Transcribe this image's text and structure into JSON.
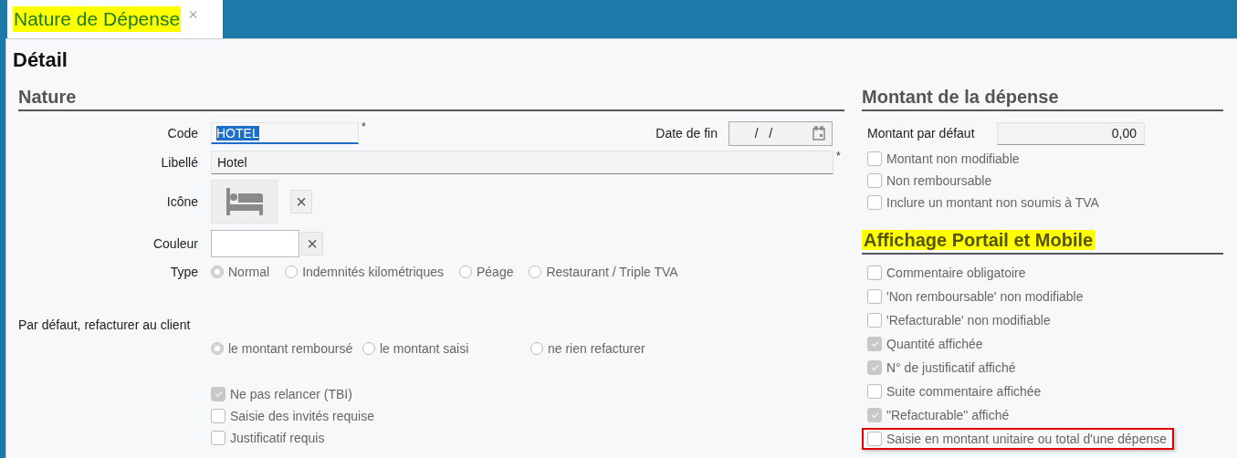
{
  "tab": {
    "title": "Nature de Dépense",
    "highlighted": true,
    "close": "×"
  },
  "heading": "Détail",
  "nature": {
    "title": "Nature",
    "code": {
      "label": "Code",
      "value": "HOTEL",
      "required": "*"
    },
    "end_date": {
      "label": "Date de fin",
      "value": "  /   /"
    },
    "libelle": {
      "label": "Libellé",
      "value": "Hotel",
      "required": "*"
    },
    "icon": {
      "label": "Icône",
      "clear": "×"
    },
    "color": {
      "label": "Couleur",
      "clear": "×"
    },
    "type": {
      "label": "Type",
      "options": [
        {
          "label": "Normal",
          "selected": true
        },
        {
          "label": "Indemnités kilométriques",
          "selected": false
        },
        {
          "label": "Péage",
          "selected": false
        },
        {
          "label": "Restaurant / Triple TVA",
          "selected": false
        }
      ]
    },
    "rebill": {
      "label": "Par défaut, refacturer au client",
      "options": [
        {
          "label": "le montant remboursé",
          "selected": true
        },
        {
          "label": "le montant saisi",
          "selected": false
        },
        {
          "label": "ne rien refacturer",
          "selected": false
        }
      ]
    },
    "checks": [
      {
        "label": "Ne pas relancer (TBI)",
        "checked": true
      },
      {
        "label": "Saisie des invités requise",
        "checked": false
      },
      {
        "label": "Justificatif requis",
        "checked": false
      }
    ]
  },
  "amount": {
    "title": "Montant de la dépense",
    "default": {
      "label": "Montant par défaut",
      "value": "0,00"
    },
    "checks": [
      {
        "label": "Montant non modifiable",
        "checked": false
      },
      {
        "label": "Non remboursable",
        "checked": false
      },
      {
        "label": "Inclure un montant non soumis à TVA",
        "checked": false
      }
    ]
  },
  "display": {
    "title": "Affichage Portail et Mobile",
    "highlighted": true,
    "checks": [
      {
        "label": "Commentaire obligatoire",
        "checked": false,
        "outlined": false
      },
      {
        "label": "'Non remboursable' non modifiable",
        "checked": false,
        "outlined": false
      },
      {
        "label": "'Refacturable' non modifiable",
        "checked": false,
        "outlined": false
      },
      {
        "label": "Quantité affichée",
        "checked": true,
        "outlined": false
      },
      {
        "label": "N° de justificatif affiché",
        "checked": true,
        "outlined": false
      },
      {
        "label": "Suite commentaire affichée",
        "checked": false,
        "outlined": false
      },
      {
        "label": "\"Refacturable\" affiché",
        "checked": true,
        "outlined": false
      },
      {
        "label": "Saisie en montant unitaire ou total d'une dépense",
        "checked": false,
        "outlined": true
      }
    ]
  }
}
